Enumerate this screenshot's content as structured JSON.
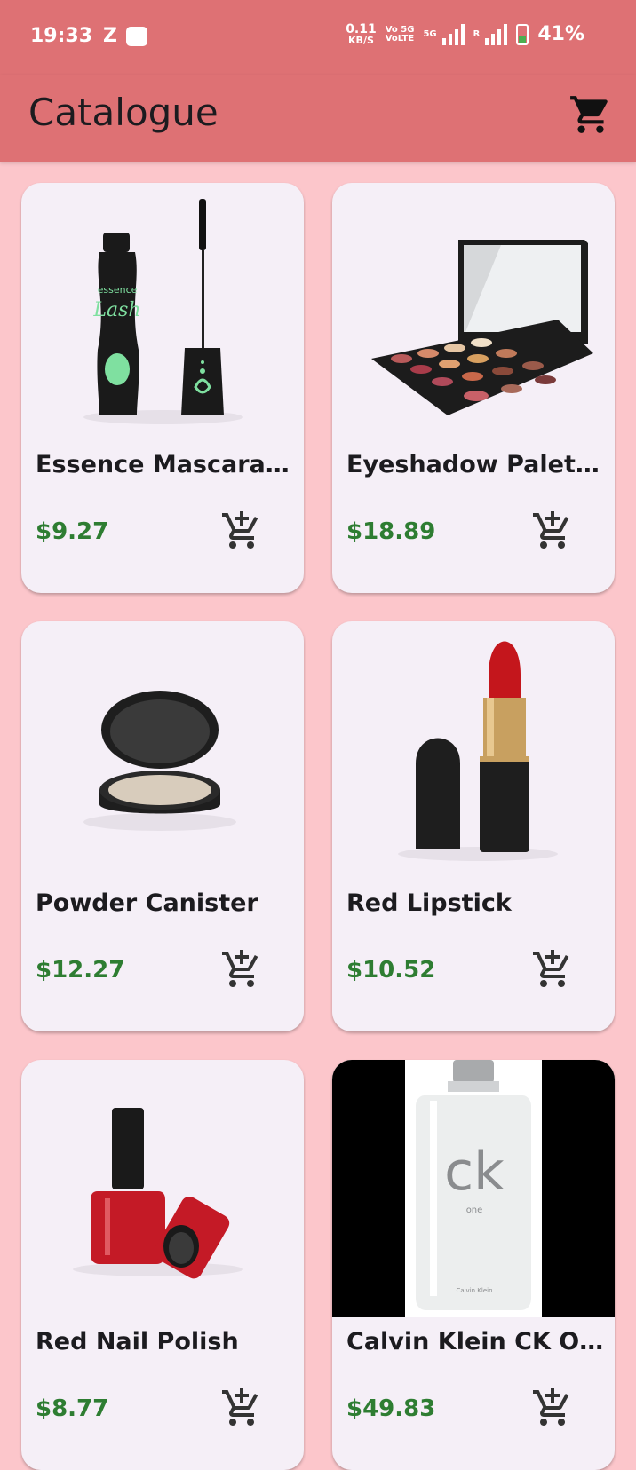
{
  "status_bar": {
    "time": "19:33",
    "app_letter": "Z",
    "net_speed_value": "0.11",
    "net_speed_unit": "KB/S",
    "volte_top": "Vo 5G",
    "volte_bottom": "VoLTE",
    "sig1_label": "5G",
    "sig2_label": "R",
    "battery": "41%"
  },
  "app_bar": {
    "title": "Catalogue",
    "cart_icon": "shopping-cart-icon"
  },
  "colors": {
    "app_bar": "#de7174",
    "background": "#fcc6cb",
    "card": "#f5eff7",
    "price": "#2e7d32"
  },
  "products": [
    {
      "name": "Essence Mascara La…",
      "price": "$9.27",
      "image": "mascara-image"
    },
    {
      "name": "Eyeshadow Palette …",
      "price": "$18.89",
      "image": "eyeshadow-palette-image"
    },
    {
      "name": "Powder Canister",
      "price": "$12.27",
      "image": "powder-canister-image"
    },
    {
      "name": "Red Lipstick",
      "price": "$10.52",
      "image": "lipstick-image"
    },
    {
      "name": "Red Nail Polish",
      "price": "$8.77",
      "image": "nail-polish-image"
    },
    {
      "name": "Calvin Klein CK One",
      "price": "$49.83",
      "image": "perfume-image",
      "image_texts": [
        "ck",
        "one",
        "Calvin Klein"
      ]
    }
  ]
}
